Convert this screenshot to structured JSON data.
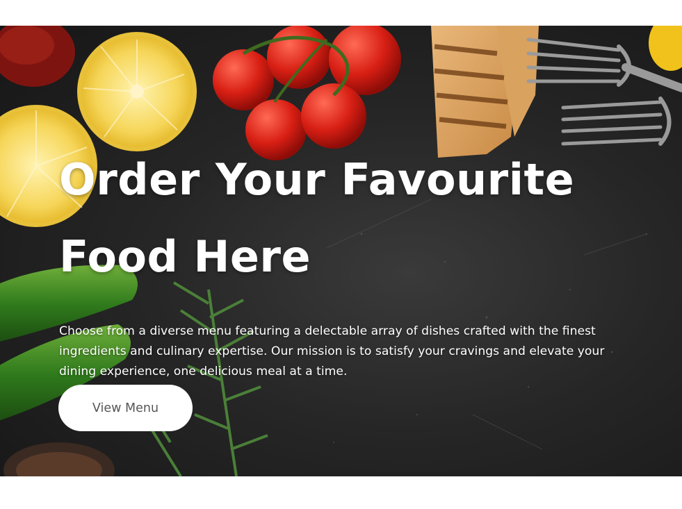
{
  "hero": {
    "title_line1": "Order Your Favourite",
    "title_line2": "Food Here",
    "description": "Choose from a diverse menu featuring a delectable array of dishes crafted with the finest ingredients and culinary expertise. Our mission is to satisfy your cravings and elevate your dining experience, one delicious meal at a time.",
    "cta_label": "View Menu"
  },
  "colors": {
    "background": "#ffffff",
    "hero_dark": "#262626",
    "title_text": "#ffffff",
    "cta_bg": "#ffffff",
    "cta_text": "#555555"
  }
}
